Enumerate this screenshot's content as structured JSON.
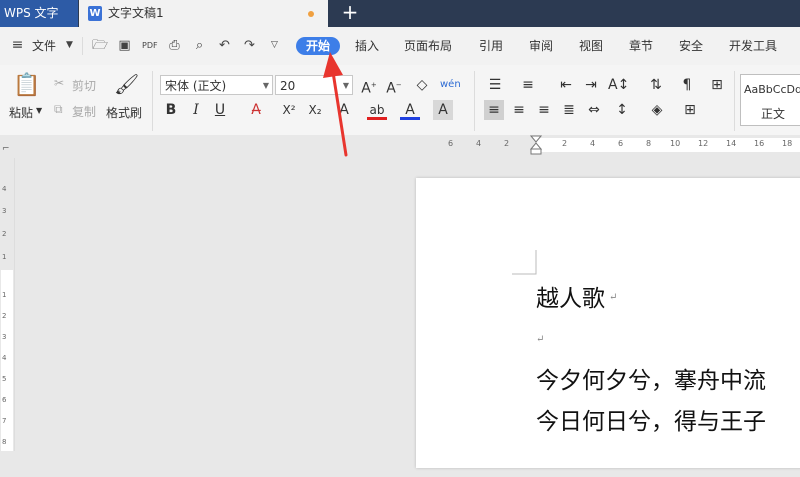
{
  "titlebar": {
    "app_tab": "WPS 文字",
    "doc_tab": "文字文稿1",
    "doc_icon": "W",
    "new_tab": "+"
  },
  "menubar": {
    "file_menu": "文件",
    "tabs": [
      "开始",
      "插入",
      "页面布局",
      "引用",
      "审阅",
      "视图",
      "章节",
      "安全",
      "开发工具"
    ],
    "active_tab": "开始"
  },
  "ribbon": {
    "paste": "粘贴",
    "cut": "剪切",
    "copy": "复制",
    "format_painter": "格式刷",
    "font_name": "宋体 (正文)",
    "font_size": "20",
    "bold": "B",
    "italic": "I",
    "underline": "U",
    "style_preview": "AaBbCcDd",
    "style_name": "正文"
  },
  "ruler": {
    "numbers": [
      "6",
      "4",
      "2",
      "2",
      "4",
      "6",
      "8",
      "10",
      "12",
      "14",
      "16",
      "18"
    ],
    "vertical_numbers": [
      "4",
      "3",
      "2",
      "1",
      "1",
      "2",
      "3",
      "4",
      "5",
      "6",
      "7",
      "8",
      "9"
    ]
  },
  "document": {
    "title": "越人歌",
    "lines": [
      "今夕何夕兮，搴舟中流",
      "今日何日兮，得与王子"
    ]
  },
  "colors": {
    "accent": "#3d7ee8",
    "tabbar": "#2c3a52",
    "annotation_arrow": "#e8352e"
  }
}
